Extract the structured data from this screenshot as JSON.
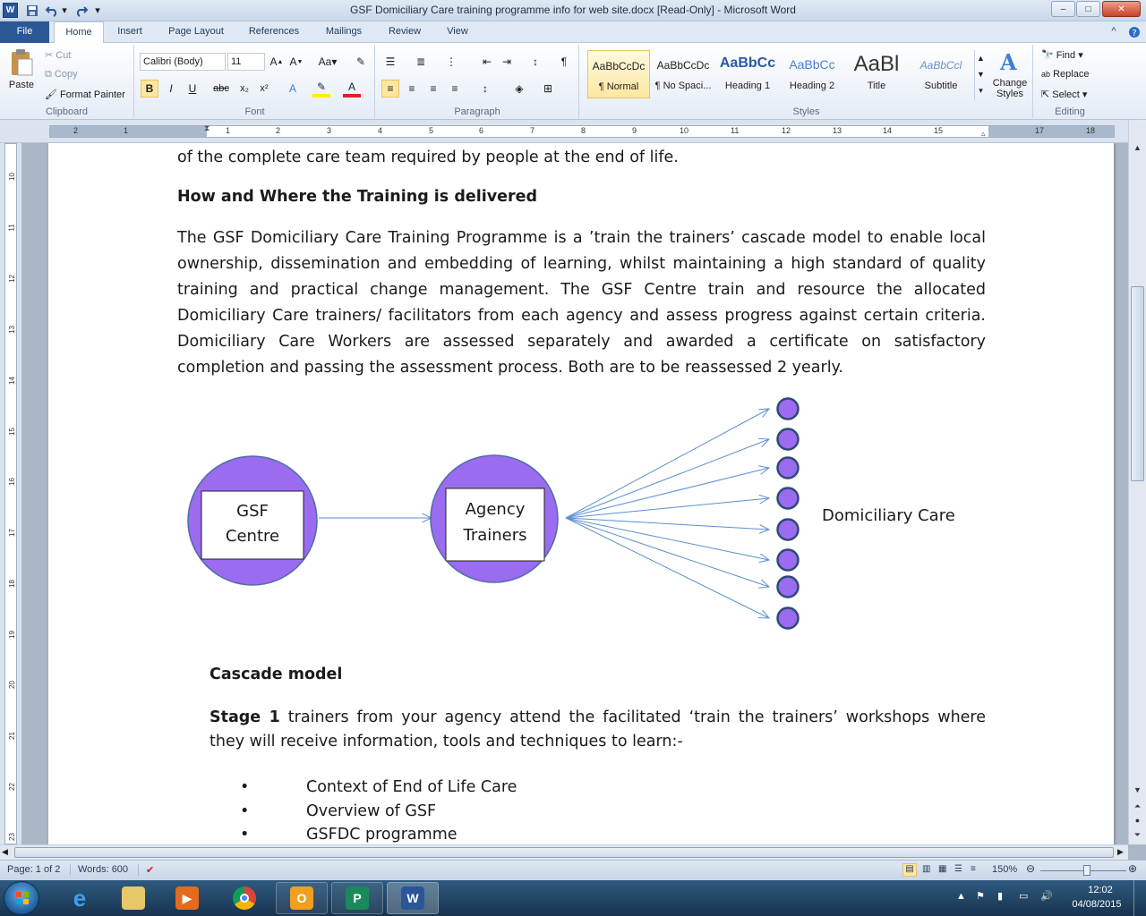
{
  "window": {
    "title": "GSF Domiciliary Care training programme info for web site.docx [Read-Only]  -  Microsoft Word",
    "app_icon": "W",
    "min": "–",
    "max": "□",
    "close": "✕"
  },
  "tabs": [
    "File",
    "Home",
    "Insert",
    "Page Layout",
    "References",
    "Mailings",
    "Review",
    "View"
  ],
  "ribbon": {
    "clipboard": {
      "paste": "Paste",
      "cut": "Cut",
      "copy": "Copy",
      "format_painter": "Format Painter",
      "label": "Clipboard"
    },
    "font": {
      "name": "Calibri (Body)",
      "size": "11",
      "label": "Font"
    },
    "paragraph": {
      "label": "Paragraph"
    },
    "styles": {
      "label": "Styles",
      "items": [
        {
          "sample": "AaBbCcDc",
          "name": "¶ Normal"
        },
        {
          "sample": "AaBbCcDc",
          "name": "¶ No Spaci..."
        },
        {
          "sample": "AaBbCc",
          "name": "Heading 1"
        },
        {
          "sample": "AaBbCc",
          "name": "Heading 2"
        },
        {
          "sample": "AaBl",
          "name": "Title"
        },
        {
          "sample": "AaBbCcl",
          "name": "Subtitle"
        }
      ],
      "change_styles": "Change Styles"
    },
    "editing": {
      "find": "Find",
      "replace": "Replace",
      "select": "Select",
      "label": "Editing"
    }
  },
  "ruler": {
    "h_numbers": [
      "2",
      "1",
      "1",
      "2",
      "3",
      "4",
      "5",
      "6",
      "7",
      "8",
      "9",
      "10",
      "11",
      "12",
      "13",
      "14",
      "15",
      "17",
      "18"
    ],
    "v_numbers": [
      "10",
      "11",
      "12",
      "13",
      "14",
      "15",
      "16",
      "17",
      "18",
      "19",
      "20",
      "21",
      "22",
      "23"
    ]
  },
  "document": {
    "line0": "of the complete care team required by people at the end of life.",
    "heading1": "How and Where the Training is delivered",
    "para1": "The GSF Domiciliary Care Training Programme is a ’train the trainers’ cascade model to enable local ownership, dissemination and embedding of learning, whilst maintaining a high standard of quality training and practical change management.  The GSF Centre train and resource the allocated Domiciliary Care trainers/ facilitators from each agency and assess progress against certain criteria.  Domiciliary Care Workers are assessed separately and awarded a certificate on satisfactory completion and passing the assessment process.  Both are to be reassessed 2 yearly.",
    "diagram": {
      "left_line1": "GSF",
      "left_line2": "Centre",
      "mid_line1": "Agency",
      "mid_line2": "Trainers",
      "right_label": "Domiciliary Care",
      "fill": "#9b6bf0",
      "node_count": 8
    },
    "heading2": "Cascade model",
    "stage_bold": "Stage 1",
    "stage_text": " trainers from your agency attend the facilitated ‘train the trainers’ workshops where they will receive information, tools and techniques to learn:-",
    "bullets": [
      "Context of End of Life Care",
      "Overview of GSF",
      "GSFDC programme"
    ]
  },
  "status": {
    "page": "Page: 1 of 2",
    "words": "Words: 600",
    "zoom": "150%"
  },
  "tray": {
    "time": "12:02",
    "date": "04/08/2015"
  }
}
